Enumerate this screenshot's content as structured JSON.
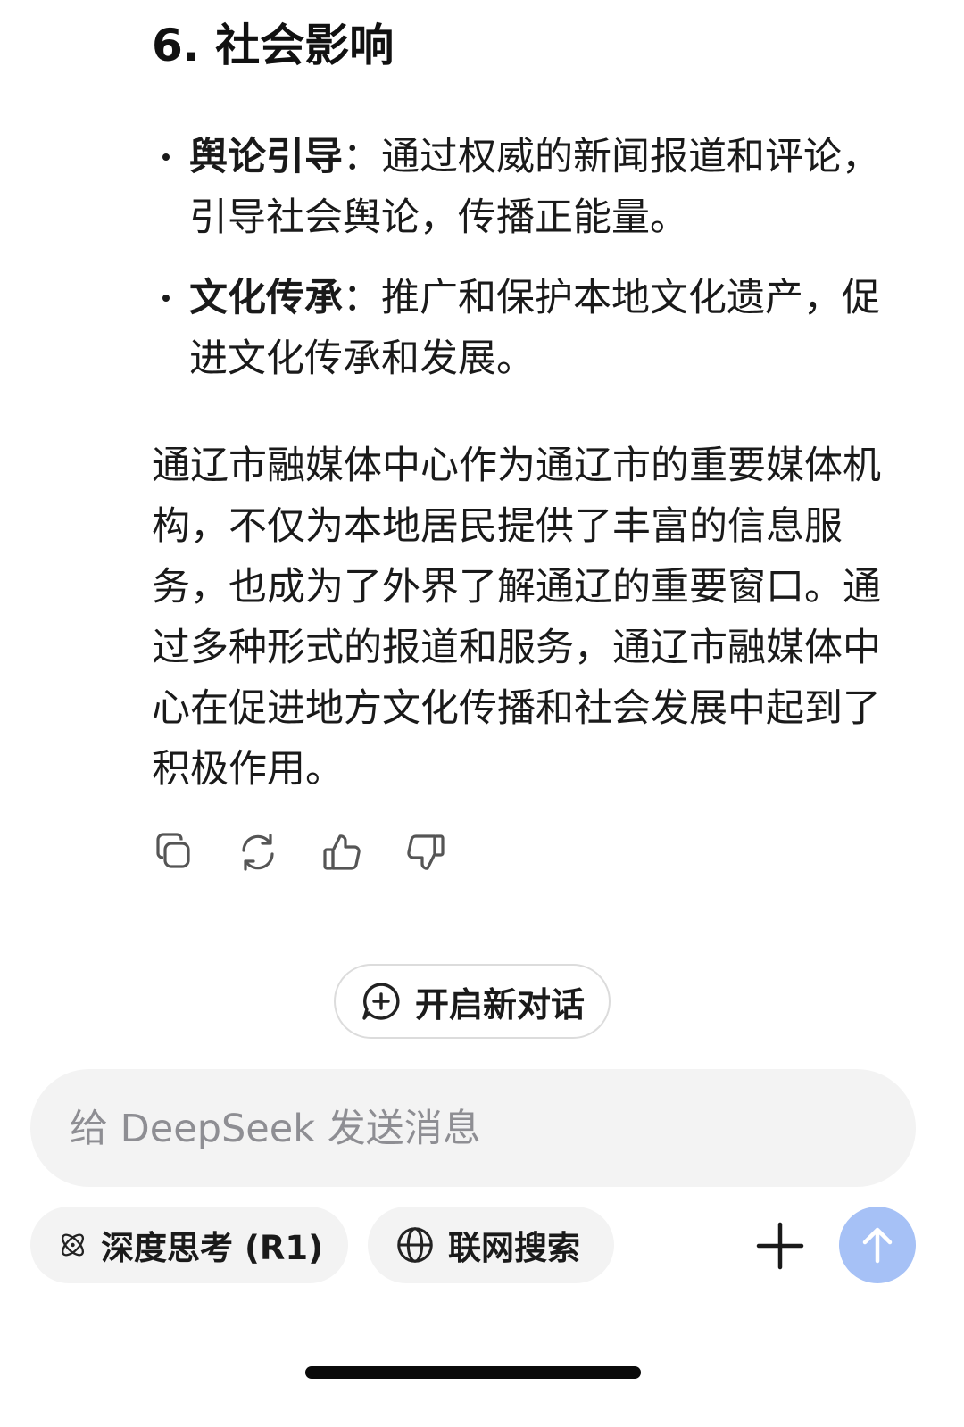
{
  "section": {
    "heading": "6. 社会影响"
  },
  "bullets": [
    {
      "term": "舆论引导",
      "colon": "：",
      "text": "通过权威的新闻报道和评论，引导社会舆论，传播正能量。"
    },
    {
      "term": "文化传承",
      "colon": "：",
      "text": "推广和保护本地文化遗产，促进文化传承和发展。"
    }
  ],
  "summary": "通辽市融媒体中心作为通辽市的重要媒体机构，不仅为本地居民提供了丰富的信息服务，也成为了外界了解通辽的重要窗口。通过多种形式的报道和服务，通辽市融媒体中心在促进地方文化传播和社会发展中起到了积极作用。",
  "actions": [
    "copy-icon",
    "regenerate-icon",
    "thumbs-up-icon",
    "thumbs-down-icon"
  ],
  "new_chat": {
    "label": "开启新对话",
    "icon": "chat-plus-icon"
  },
  "composer": {
    "placeholder": "给 DeepSeek 发送消息",
    "value": ""
  },
  "toggles": {
    "deep_think": {
      "label": "深度思考 (R1)",
      "icon": "atom-icon"
    },
    "web_search": {
      "label": "联网搜索",
      "icon": "globe-icon"
    }
  },
  "buttons": {
    "attach_icon": "plus-icon",
    "send_icon": "arrow-up-icon"
  },
  "colors": {
    "send_button": "#a6c1f6",
    "pill_background": "#f3f3f3",
    "text": "#1a1a1a"
  }
}
